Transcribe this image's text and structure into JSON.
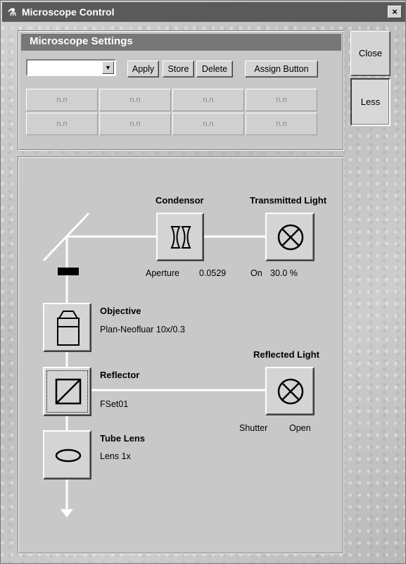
{
  "window": {
    "title": "Microscope Control",
    "close_glyph": "×",
    "icon": "microscope-icon"
  },
  "side_buttons": {
    "close_label": "Close",
    "less_label": "Less"
  },
  "settings": {
    "header": "Microscope Settings",
    "combo_value": "",
    "apply_label": "Apply",
    "store_label": "Store",
    "delete_label": "Delete",
    "assign_label": "Assign Button",
    "slots": [
      "n.n",
      "n.n",
      "n.n",
      "n.n",
      "n.n",
      "n.n",
      "n.n",
      "n.n"
    ]
  },
  "light_path": {
    "condensor": {
      "title": "Condensor",
      "aperture_label": "Aperture",
      "aperture_value": "0.0529",
      "icon": "condensor-lens-icon"
    },
    "transmitted": {
      "title": "Transmitted Light",
      "state": "On",
      "value": "30.0 %",
      "icon": "lamp-icon"
    },
    "objective": {
      "title": "Objective",
      "value": "Plan-Neofluar 10x/0.3",
      "icon": "objective-icon"
    },
    "reflected": {
      "title": "Reflected Light",
      "shutter_label": "Shutter",
      "shutter_value": "Open",
      "icon": "lamp-icon"
    },
    "reflector": {
      "title": "Reflector",
      "value": "FSet01",
      "icon": "reflector-cube-icon"
    },
    "tube_lens": {
      "title": "Tube Lens",
      "value": "Lens 1x",
      "icon": "tube-lens-icon"
    }
  }
}
